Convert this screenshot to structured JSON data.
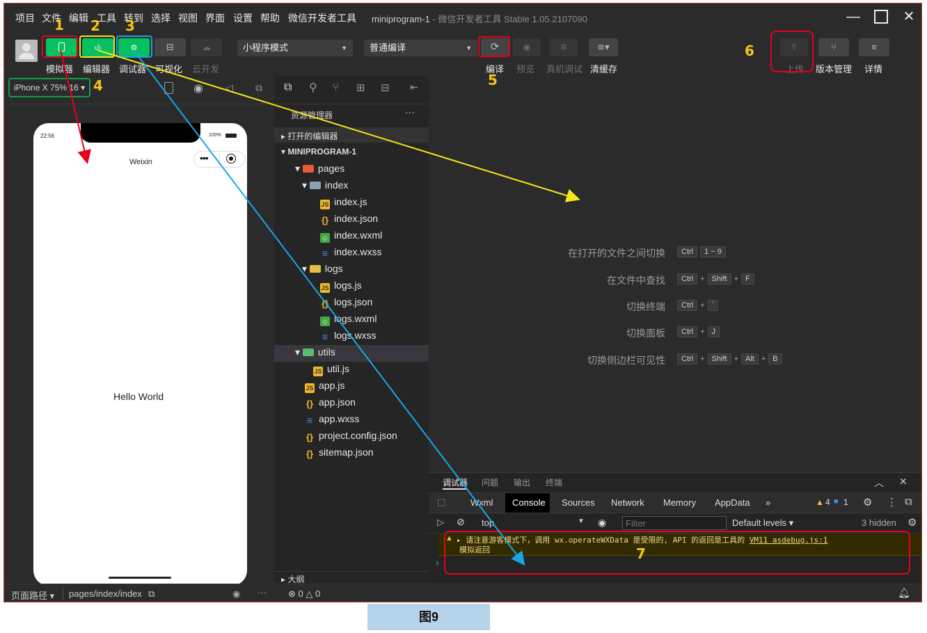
{
  "menubar": {
    "items": [
      "项目",
      "文件",
      "编辑",
      "工具",
      "转到",
      "选择",
      "视图",
      "界面",
      "设置",
      "帮助",
      "微信开发者工具"
    ],
    "title_project": "miniprogram-1",
    "title_rest": " - 微信开发者工具 Stable 1.05.2107090"
  },
  "toolbar": {
    "buttons": [
      {
        "label": "模拟器",
        "icon": "phone-icon"
      },
      {
        "label": "编辑器",
        "icon": "code-icon"
      },
      {
        "label": "调试器",
        "icon": "debug-icon"
      },
      {
        "label": "可视化",
        "icon": "layout-icon"
      },
      {
        "label": "云开发",
        "icon": "cloud-icon"
      }
    ],
    "mode_select": "小程序模式",
    "compile_select": "普通编译",
    "actions": [
      {
        "label": "编译",
        "icon": "refresh-icon"
      },
      {
        "label": "预览",
        "icon": "eye-icon"
      },
      {
        "label": "真机调试",
        "icon": "bug-icon"
      },
      {
        "label": "清缓存",
        "icon": "layers-icon"
      }
    ],
    "right": [
      {
        "label": "上传",
        "icon": "upload-icon"
      },
      {
        "label": "版本管理",
        "icon": "branch-icon"
      },
      {
        "label": "详情",
        "icon": "menu-icon"
      }
    ]
  },
  "simulator": {
    "device": "iPhone X 75% 16 ▾",
    "time": "22:56",
    "battery": "100%",
    "nav_title": "Weixin",
    "content": "Hello World"
  },
  "explorer": {
    "header": "资源管理器",
    "open_editors": "打开的编辑器",
    "project": "MINIPROGRAM-1",
    "outline": "大纲",
    "tree": [
      {
        "name": "pages",
        "type": "folder"
      },
      {
        "name": "index",
        "type": "folder"
      },
      {
        "name": "index.js",
        "type": "js"
      },
      {
        "name": "index.json",
        "type": "json"
      },
      {
        "name": "index.wxml",
        "type": "wxml"
      },
      {
        "name": "index.wxss",
        "type": "wxss"
      },
      {
        "name": "logs",
        "type": "folder"
      },
      {
        "name": "logs.js",
        "type": "js"
      },
      {
        "name": "logs.json",
        "type": "json"
      },
      {
        "name": "logs.wxml",
        "type": "wxml"
      },
      {
        "name": "logs.wxss",
        "type": "wxss"
      },
      {
        "name": "utils",
        "type": "folder"
      },
      {
        "name": "util.js",
        "type": "js"
      },
      {
        "name": "app.js",
        "type": "js"
      },
      {
        "name": "app.json",
        "type": "json"
      },
      {
        "name": "app.wxss",
        "type": "wxss"
      },
      {
        "name": "project.config.json",
        "type": "json"
      },
      {
        "name": "sitemap.json",
        "type": "json"
      }
    ]
  },
  "editor": {
    "shortcuts": [
      {
        "label": "在打开的文件之间切换",
        "keys": [
          "Ctrl",
          "1 ~ 9"
        ]
      },
      {
        "label": "在文件中查找",
        "keys": [
          "Ctrl",
          "+",
          "Shift",
          "+",
          "F"
        ]
      },
      {
        "label": "切换终端",
        "keys": [
          "Ctrl",
          "+",
          "`"
        ]
      },
      {
        "label": "切换面板",
        "keys": [
          "Ctrl",
          "+",
          "J"
        ]
      },
      {
        "label": "切换侧边栏可见性",
        "keys": [
          "Ctrl",
          "+",
          "Shift",
          "+",
          "Alt",
          "+",
          "B"
        ]
      }
    ]
  },
  "devtools": {
    "panel_tabs": [
      "调试器",
      "问题",
      "输出",
      "终端"
    ],
    "tabs": [
      "Wxml",
      "Console",
      "Sources",
      "Network",
      "Memory",
      "AppData",
      "»"
    ],
    "warn_count": "4",
    "info_count": "1",
    "context": "top",
    "filter_placeholder": "Filter",
    "levels": "Default levels ▾",
    "hidden": "3 hidden",
    "warning_line1": "▸ 请注意游客模式下，调用 wx.operateWXData 是受限的, API 的返回是工具的 ",
    "warning_link": "VM11 asdebug.js:1",
    "warning_line2": "模拟返回",
    "prompt": "›"
  },
  "statusbar": {
    "path_label": "页面路径 ▾",
    "path": "pages/index/index",
    "problems": "⊗ 0  △ 0"
  },
  "annotations": [
    "1",
    "2",
    "3",
    "4",
    "5",
    "6",
    "7"
  ],
  "caption": "图9",
  "colors": {
    "accent_green": "#07c160",
    "red": "#e8001c",
    "yellow": "#f5e61a",
    "blue": "#1aa5e6",
    "number": "#f5c518"
  }
}
